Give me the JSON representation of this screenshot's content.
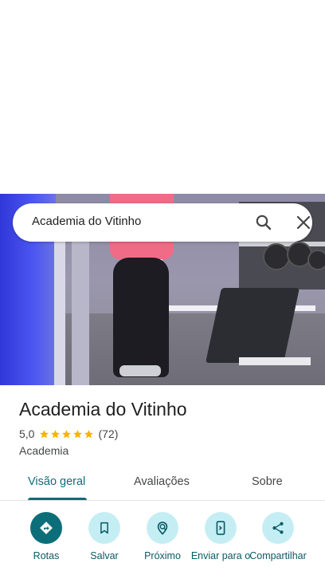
{
  "search": {
    "query": "Academia do Vitinho"
  },
  "place": {
    "name": "Academia do Vitinho",
    "rating": "5,0",
    "reviews": "(72)",
    "stars": 5,
    "category": "Academia"
  },
  "tabs": [
    "Visão geral",
    "Avaliações",
    "Sobre"
  ],
  "actions": {
    "directions": "Rotas",
    "save": "Salvar",
    "nearby": "Próximo",
    "send": "Enviar para o",
    "share": "Compartilhar"
  },
  "colors": {
    "accent": "#0b6e78",
    "chip_bg": "#c5eef4",
    "star": "#f5b400"
  },
  "icons": [
    "search-icon",
    "close-icon",
    "star-icon",
    "directions-icon",
    "bookmark-icon",
    "nearby-icon",
    "send-to-phone-icon",
    "share-icon"
  ]
}
